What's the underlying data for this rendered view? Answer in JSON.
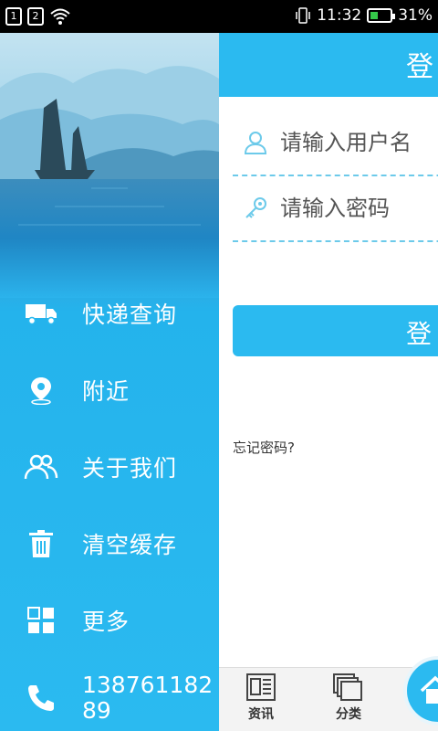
{
  "status_bar": {
    "sim1": "1",
    "sim2": "2",
    "time": "11:32",
    "battery": "31%"
  },
  "drawer": {
    "items": [
      {
        "label": "快递查询",
        "icon": "truck-icon"
      },
      {
        "label": "附近",
        "icon": "location-pin-icon"
      },
      {
        "label": "关于我们",
        "icon": "people-icon"
      },
      {
        "label": "清空缓存",
        "icon": "trash-icon"
      },
      {
        "label": "更多",
        "icon": "grid-icon"
      }
    ],
    "phone": {
      "number": "13876118289",
      "icon": "phone-icon"
    }
  },
  "main": {
    "title": "登",
    "username_placeholder": "请输入用户名",
    "password_placeholder": "请输入密码",
    "login_label": "登",
    "forgot_label": "忘记密码?"
  },
  "tabbar": {
    "tabs": [
      {
        "label": "资讯",
        "icon": "newspaper-icon"
      },
      {
        "label": "分类",
        "icon": "category-icon"
      }
    ],
    "home_icon": "home-icon"
  },
  "colors": {
    "accent": "#2bbaf0",
    "status_bar": "#000000",
    "battery": "#35c84a"
  }
}
